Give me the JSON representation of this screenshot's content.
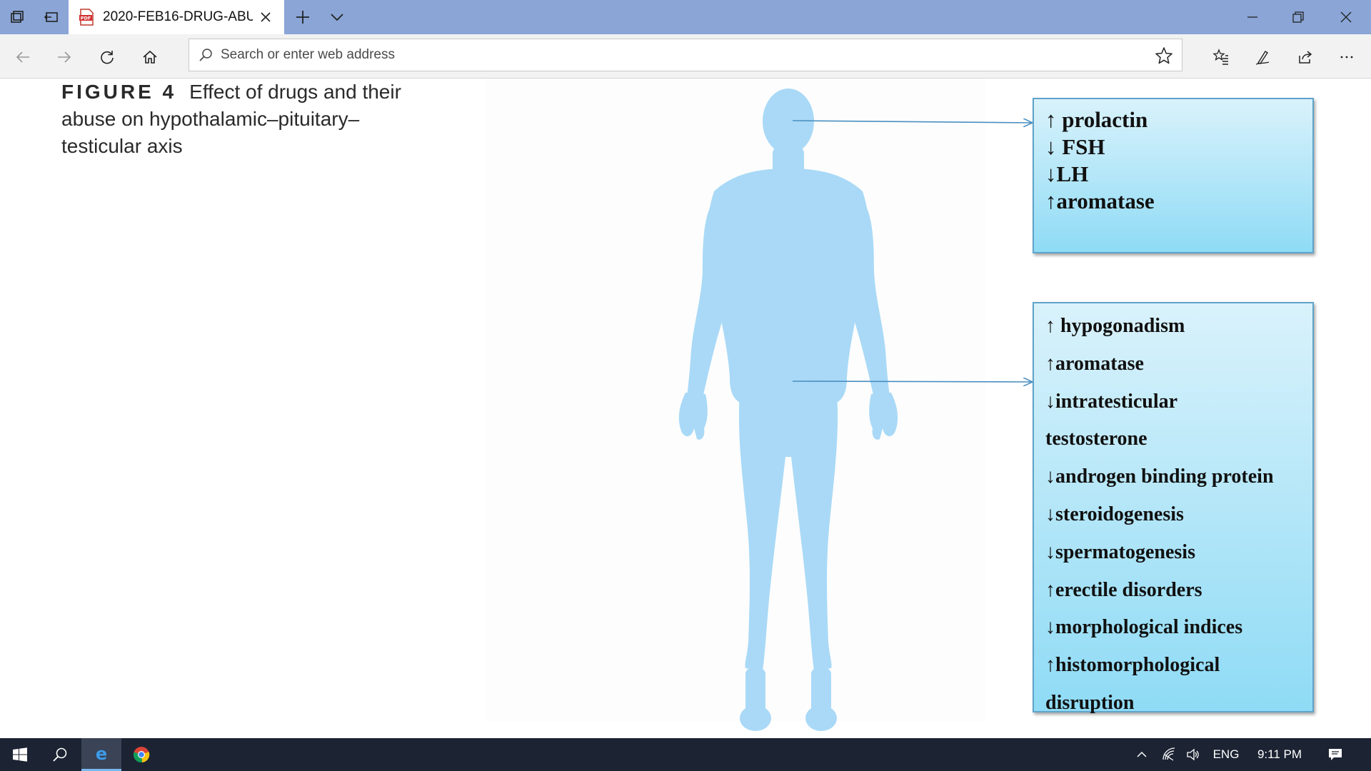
{
  "browser": {
    "tab": {
      "title": "2020-FEB16-DRUG-ABU",
      "icon": "pdf-file-icon"
    },
    "address": {
      "placeholder": "Search or enter web address",
      "value": ""
    },
    "accent": "#8aa5d6"
  },
  "figure": {
    "label": "FIGURE 4",
    "caption": "Effect of drugs and their abuse on hypothalamic–pituitary–testicular axis",
    "body_color": "#a9d9f7",
    "box_color": "#8fdbf5",
    "arrow_color": "#4a8fc1",
    "head_effects": [
      "↑ prolactin",
      "↓ FSH",
      "↓LH",
      "↑aromatase"
    ],
    "testis_effects": [
      "↑ hypogonadism",
      "↑aromatase",
      "↓intratesticular",
      "testosterone",
      "↓androgen binding protein",
      "↓steroidogenesis",
      "↓spermatogenesis",
      "↑erectile disorders",
      "↓morphological indices",
      "↑histomorphological",
      "disruption"
    ]
  },
  "taskbar": {
    "language": "ENG",
    "time": "9:11 PM",
    "background": "#1c2333"
  }
}
